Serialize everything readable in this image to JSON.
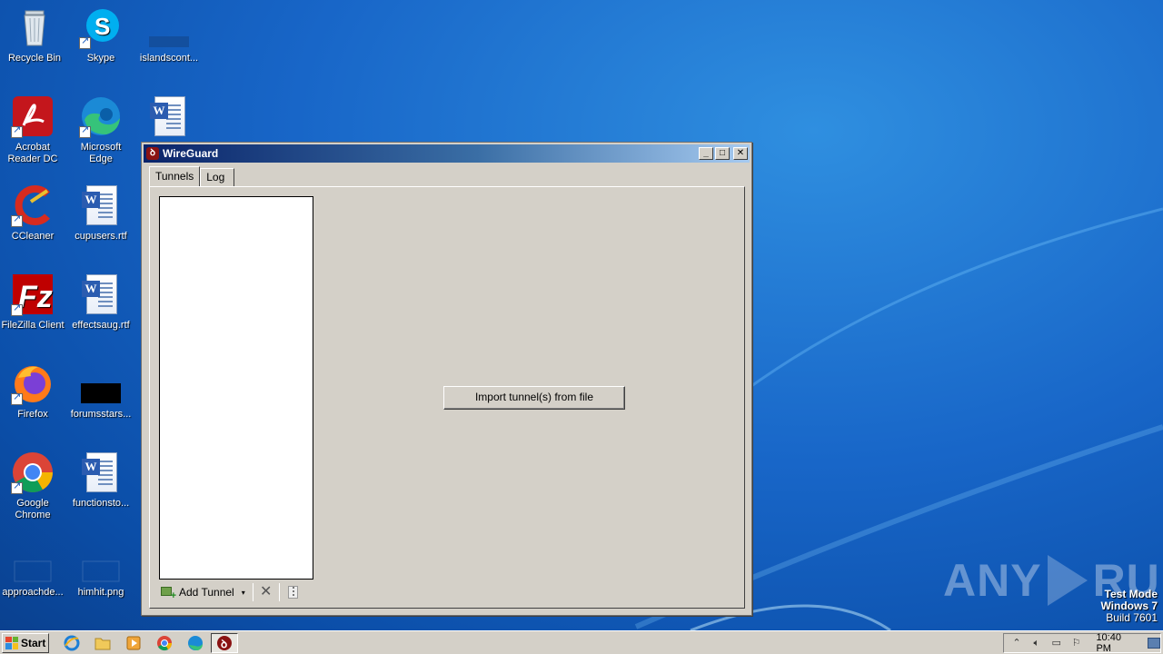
{
  "desktop": {
    "icons": [
      {
        "label": "Recycle Bin"
      },
      {
        "label": "Skype"
      },
      {
        "label": "islandscont..."
      },
      {
        "label": "Acrobat Reader DC"
      },
      {
        "label": "Microsoft Edge"
      },
      {
        "label": ""
      },
      {
        "label": "CCleaner"
      },
      {
        "label": "cupusers.rtf"
      },
      {
        "label": "FileZilla Client"
      },
      {
        "label": "effectsaug.rtf"
      },
      {
        "label": "Firefox"
      },
      {
        "label": "forumsstars..."
      },
      {
        "label": "Google Chrome"
      },
      {
        "label": "functionsto..."
      },
      {
        "label": "approachde..."
      },
      {
        "label": "himhit.png"
      }
    ]
  },
  "window": {
    "title": "WireGuard",
    "tabs": [
      {
        "label": "Tunnels"
      },
      {
        "label": "Log"
      }
    ],
    "import_button": "Import tunnel(s) from file",
    "toolbar": {
      "add_tunnel": "Add Tunnel",
      "dropdown_icon": "▾",
      "delete_icon": "✕"
    },
    "controls": {
      "minimize": "_",
      "maximize": "□",
      "close": "✕"
    }
  },
  "watermark": {
    "left": "ANY",
    "right": "RUN"
  },
  "test_mode": {
    "line1": "Test Mode",
    "line2": "Windows 7",
    "line3": "Build 7601"
  },
  "taskbar": {
    "start_label": "Start",
    "clock": "10:40 PM",
    "tray_icons": [
      "up-arrow-icon",
      "volume-icon",
      "network-icon",
      "flag-icon"
    ]
  },
  "colors": {
    "desktop_blue": "#1866c8",
    "titlebar_dark": "#0a246a",
    "window_face": "#d4d0c8",
    "wireguard_red": "#8a1313"
  }
}
